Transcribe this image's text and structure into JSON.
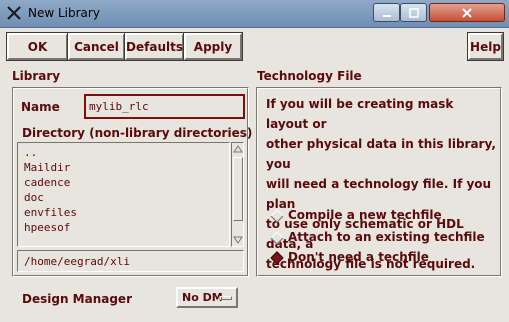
{
  "window": {
    "title": "New Library"
  },
  "toolbar": {
    "ok": "OK",
    "cancel": "Cancel",
    "defaults": "Defaults",
    "apply": "Apply",
    "help": "Help"
  },
  "library": {
    "section_label": "Library",
    "name_label": "Name",
    "name_value": "mylib_rlc",
    "directory_label": "Directory (non-library directories)",
    "directories": [
      "..",
      "Maildir",
      "cadence",
      "doc",
      "envfiles",
      "hpeesof"
    ],
    "path_value": "/home/eegrad/xli"
  },
  "design_manager": {
    "label": "Design Manager",
    "value": "No DM"
  },
  "technology": {
    "section_label": "Technology File",
    "description_lines": [
      "If you will be creating mask layout or",
      "other physical data in this library, you",
      "will need a technology file. If you plan",
      "to use only schematic or HDL data, a",
      "technology file is not required."
    ],
    "options": [
      {
        "label": "Compile a new techfile",
        "selected": false
      },
      {
        "label": "Attach to an existing techfile",
        "selected": false
      },
      {
        "label": "Don't need a techfile",
        "selected": true
      }
    ]
  },
  "colors": {
    "text": "#5a0a0a",
    "background": "#e8e4de",
    "titlebar": "#7f9bbd",
    "close": "#c6503a"
  }
}
